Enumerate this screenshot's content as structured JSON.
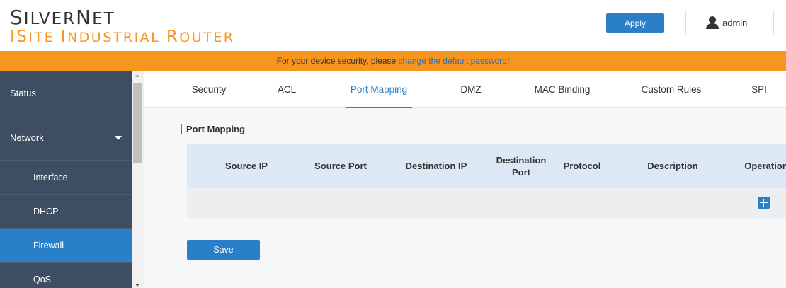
{
  "brand": {
    "name_first": "S",
    "name_rest": "ILVER",
    "name_first2": "N",
    "name_rest2": "ET",
    "sub_first": "IS",
    "sub_rest": "ITE ",
    "sub_first2": "I",
    "sub_rest2": "NDUSTRIAL ",
    "sub_first3": "R",
    "sub_rest3": "OUTER"
  },
  "header": {
    "apply_label": "Apply",
    "user_name": "admin"
  },
  "banner": {
    "text_before": "For your device security, please ",
    "link_text": "change the default password",
    "text_after": "!"
  },
  "sidebar": {
    "items": [
      {
        "label": "Status"
      },
      {
        "label": "Network"
      },
      {
        "label": "Interface"
      },
      {
        "label": "DHCP"
      },
      {
        "label": "Firewall"
      },
      {
        "label": "QoS"
      }
    ],
    "active": "Firewall"
  },
  "tabs": [
    {
      "label": "Security"
    },
    {
      "label": "ACL"
    },
    {
      "label": "Port Mapping"
    },
    {
      "label": "DMZ"
    },
    {
      "label": "MAC Binding"
    },
    {
      "label": "Custom Rules"
    },
    {
      "label": "SPI"
    }
  ],
  "active_tab": "Port Mapping",
  "main": {
    "section_title": "Port Mapping",
    "columns": [
      "Source IP",
      "Source Port",
      "Destination IP",
      "Destination Port",
      "Protocol",
      "Description",
      "Operation"
    ],
    "save_label": "Save"
  },
  "colors": {
    "accent": "#2980c9",
    "banner": "#f7961e",
    "sidebar": "#3e4e62"
  }
}
